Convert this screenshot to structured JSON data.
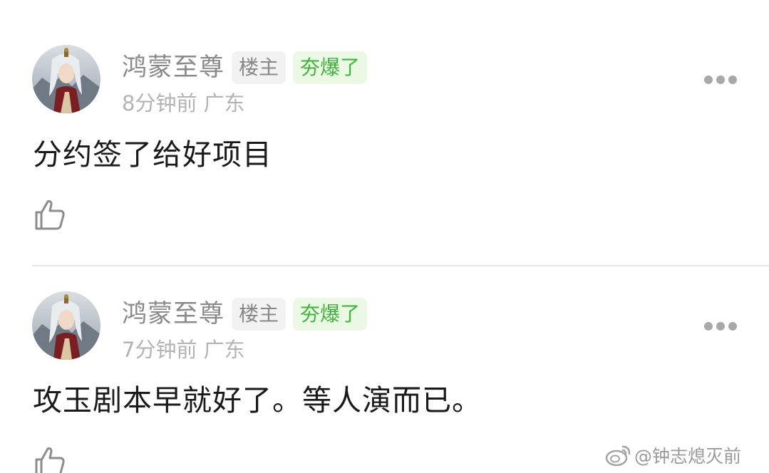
{
  "comments": [
    {
      "username": "鸿蒙至尊",
      "op_badge": "楼主",
      "hot_badge": "夯爆了",
      "time": "8分钟前",
      "location": "广东",
      "content": "分约签了给好项目"
    },
    {
      "username": "鸿蒙至尊",
      "op_badge": "楼主",
      "hot_badge": "夯爆了",
      "time": "7分钟前",
      "location": "广东",
      "content": "攻玉剧本早就好了。等人演而已。"
    }
  ],
  "icons": {
    "more": "more-dots-icon",
    "like": "thumbs-up-icon",
    "watermark": "weibo-logo-icon"
  },
  "colors": {
    "hot_badge_text": "#3db53a",
    "hot_badge_bg": "#eaf8e4",
    "op_badge_bg": "#f2f2f2",
    "username": "#8a8a8a",
    "meta": "#b3b3b3"
  },
  "watermark": {
    "text": "@钟志熄灭前"
  }
}
